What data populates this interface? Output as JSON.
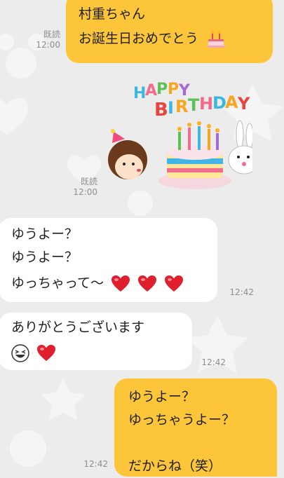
{
  "messages": [
    {
      "side": "out",
      "lines": [
        "村重ちゃん",
        "お誕生日おめでとう"
      ],
      "read": "既読",
      "time": "12:00"
    },
    {
      "side": "out",
      "sticker": {
        "text": "HAPPY BIRTHDAY"
      },
      "read": "既読",
      "time": "12:00"
    },
    {
      "side": "in",
      "lines": [
        "ゆうよー？",
        "ゆうよー？",
        "ゆっちゃって〜"
      ],
      "time": "12:42"
    },
    {
      "side": "in",
      "lines": [
        "ありがとうございます"
      ],
      "time": "12:42"
    },
    {
      "side": "out",
      "lines": [
        "ゆうよー？",
        "ゆっちゃうよー？",
        "",
        "だからね（笑）"
      ],
      "time": "12:42"
    }
  ],
  "colors": {
    "outgoing": "#fdc63a",
    "incoming": "#ffffff",
    "background": "#ececec",
    "meta": "#8e8e8e"
  },
  "icons": [
    "cake-icon",
    "heart-icon",
    "laughing-face-icon"
  ]
}
